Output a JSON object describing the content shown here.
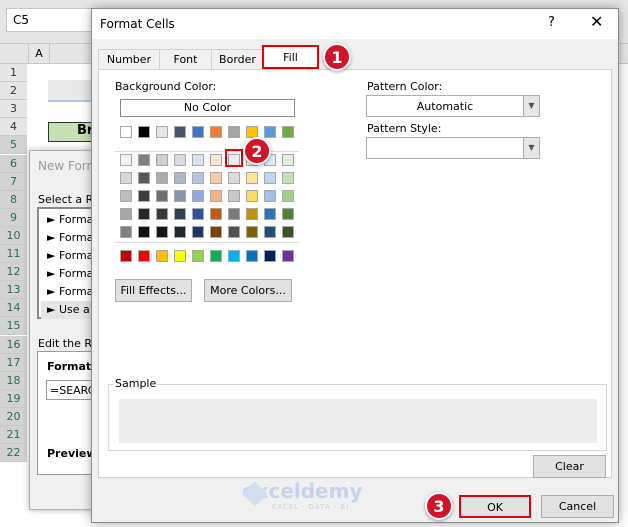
{
  "sheet": {
    "name_box": "C5",
    "column": "A",
    "rows": [
      "1",
      "2",
      "3",
      "4",
      "5",
      "6",
      "7",
      "8",
      "9",
      "10",
      "11",
      "12",
      "13",
      "14",
      "15",
      "16",
      "17",
      "18",
      "19",
      "20",
      "21",
      "22"
    ],
    "cell_b4": "Br"
  },
  "background_dialog": {
    "title": "New Form",
    "select_rule": "Select a Ru",
    "rules": [
      "► Format",
      "► Format",
      "► Format",
      "► Format",
      "► Format",
      "► Use a f"
    ],
    "edit_rule": "Edit the Ru",
    "format_values": "Format v",
    "formula": "=SEARC",
    "preview": "Preview:"
  },
  "dialog": {
    "title": "Format Cells",
    "help": "?",
    "close": "✕",
    "tabs": [
      {
        "label": "Number"
      },
      {
        "label": "Font"
      },
      {
        "label": "Border"
      },
      {
        "label": "Fill",
        "active": true
      }
    ],
    "background_color_label": "Background Color:",
    "no_color": "No Color",
    "theme_colors": [
      "#FFFFFF",
      "#000000",
      "#E7E6E6",
      "#44546A",
      "#4472C4",
      "#ED7D31",
      "#A5A5A5",
      "#FFC000",
      "#5B9BD5",
      "#70AD47"
    ],
    "tint_rows": [
      [
        "#F2F2F2",
        "#7F7F7F",
        "#D0CECE",
        "#D6DCE4",
        "#D9E2F3",
        "#FBE5D5",
        "#EDEDED",
        "#FFF2CC",
        "#DEEBF6",
        "#E2EFD9"
      ],
      [
        "#D8D8D8",
        "#595959",
        "#AEABAB",
        "#ADB9CA",
        "#B4C6E7",
        "#F7CBAC",
        "#DBDBDB",
        "#FFE599",
        "#BDD7EE",
        "#C5E0B3"
      ],
      [
        "#BFBFBF",
        "#3F3F3F",
        "#757070",
        "#8496B0",
        "#8EAADB",
        "#F4B183",
        "#C9C9C9",
        "#FFD965",
        "#9DC3E6",
        "#A8D08D"
      ],
      [
        "#A5A5A5",
        "#262626",
        "#3A3838",
        "#323F4F",
        "#2F5496",
        "#C55A11",
        "#7B7B7B",
        "#BF9000",
        "#2E75B5",
        "#538135"
      ],
      [
        "#7F7F7F",
        "#0C0C0C",
        "#171616",
        "#222A35",
        "#1F3864",
        "#833C0B",
        "#525252",
        "#7F6000",
        "#1E4E79",
        "#375623"
      ]
    ],
    "standard_colors": [
      "#C00000",
      "#FF0000",
      "#FFC000",
      "#FFFF00",
      "#92D050",
      "#00B050",
      "#00B0F0",
      "#0070C0",
      "#002060",
      "#7030A0"
    ],
    "selected_color": "#EDEDED",
    "fill_effects": "Fill Effects...",
    "more_colors": "More Colors...",
    "pattern_color_label": "Pattern Color:",
    "pattern_color_value": "Automatic",
    "pattern_style_label": "Pattern Style:",
    "pattern_style_value": "",
    "sample_label": "Sample",
    "clear": "Clear",
    "ok": "OK",
    "cancel": "Cancel"
  },
  "annotations": {
    "step1": "1",
    "step2": "2",
    "step3": "3",
    "accent": "#D0142A"
  },
  "watermark": {
    "brand": "exceldemy",
    "tagline": "EXCEL · DATA · BI"
  }
}
